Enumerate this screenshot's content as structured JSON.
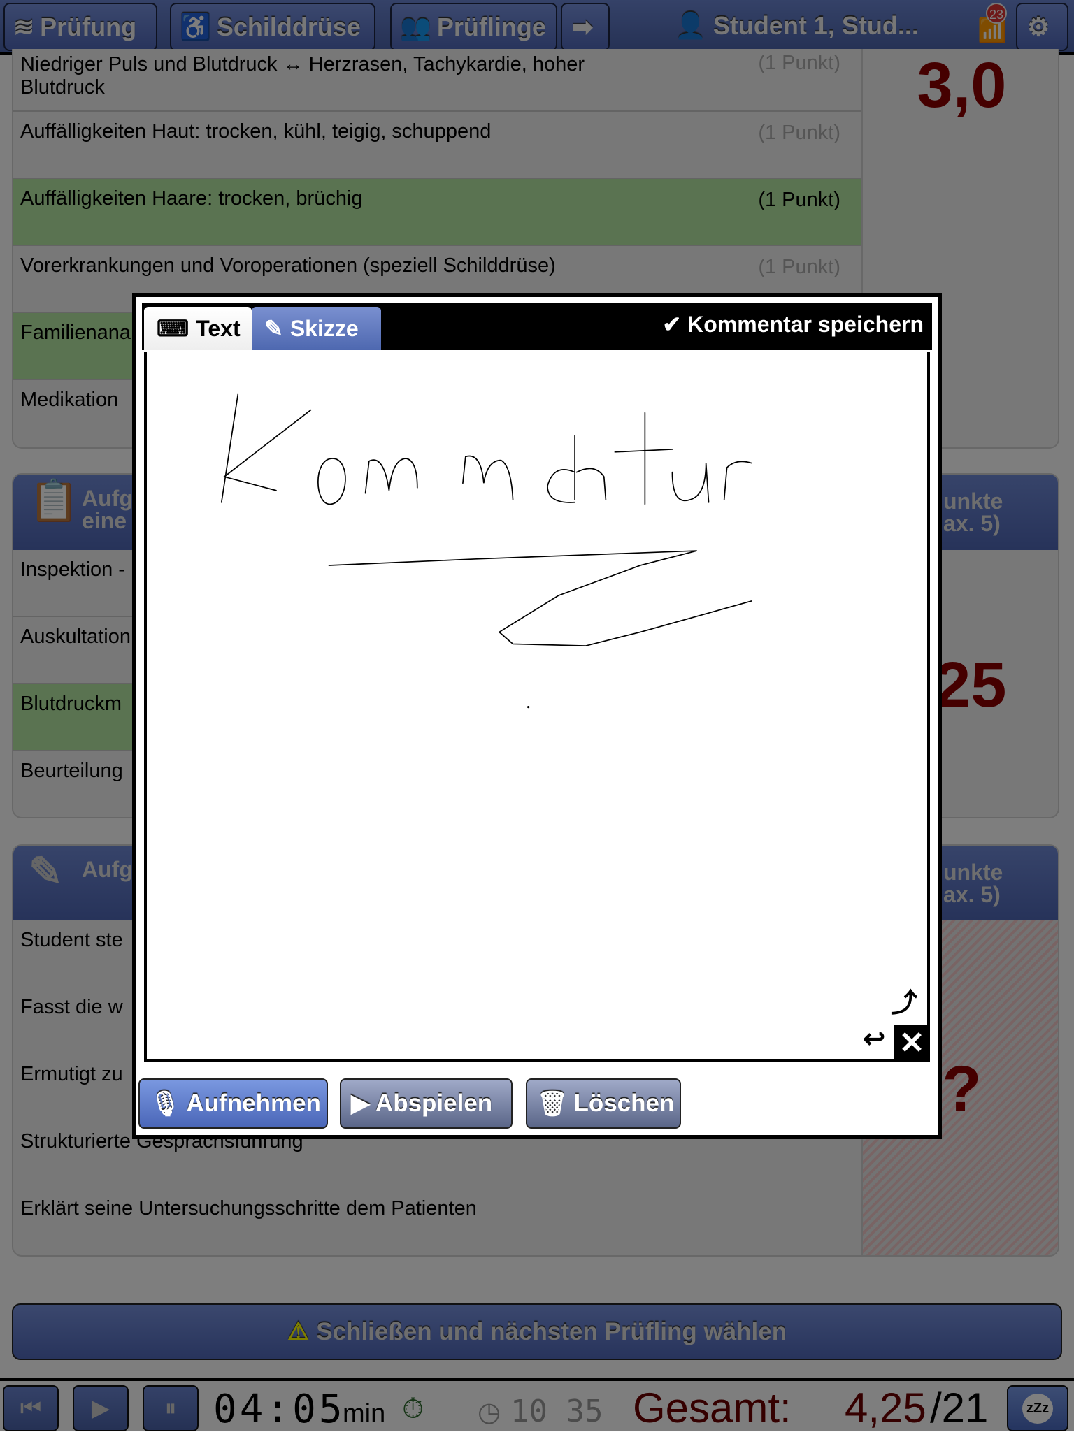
{
  "topbar": {
    "pruefung": "Prüfung",
    "schilddruese": "Schilddrüse",
    "prueflinge": "Prüflinge",
    "student": "Student 1, Stud...",
    "badge_count": "23"
  },
  "section1": {
    "rows": [
      {
        "text": "Niedriger Puls und Blutdruck ↔ Herzrasen, Tachykardie, hoher Blutdruck",
        "points": "(1 Punkt)",
        "selected": false
      },
      {
        "text": "Auffälligkeiten Haut: trocken, kühl, teigig, schuppend",
        "points": "(1 Punkt)",
        "selected": false
      },
      {
        "text": "Auffälligkeiten Haare: trocken, brüchig",
        "points": "(1 Punkt)",
        "selected": true
      },
      {
        "text": "Vorerkrankungen und Voroperationen (speziell Schilddrüse)",
        "points": "(1 Punkt)",
        "selected": false
      },
      {
        "text": "Familienana",
        "points": "",
        "selected": true
      },
      {
        "text": "Medikation",
        "points": "",
        "selected": false
      }
    ],
    "score": "3,0"
  },
  "section2": {
    "title_line1": "Aufg",
    "title_line2": "eine",
    "points_header_line1": "unkte",
    "points_header_line2": "ax. 5)",
    "rows": [
      {
        "text": "Inspektion -",
        "selected": false
      },
      {
        "text": "Auskultation",
        "selected": false
      },
      {
        "text": "Blutdruckm",
        "selected": true
      },
      {
        "text": "Beurteilung",
        "selected": false
      }
    ],
    "score": ",25"
  },
  "section3": {
    "title_line1": "Aufg",
    "points_header_line1": "unkte",
    "points_header_line2": "ax. 5)",
    "rows": [
      {
        "text": "Student ste"
      },
      {
        "text": "Fasst die w"
      },
      {
        "text": "Ermutigt zu"
      },
      {
        "text": "Strukturierte Gesprächsführung"
      },
      {
        "text": "Erklärt seine Untersuchungsschritte dem Patienten"
      }
    ],
    "score": "?"
  },
  "close_next": "Schließen und nächsten Prüfling wählen",
  "modal": {
    "tab_text": "Text",
    "tab_sketch": "Skizze",
    "save": "Kommentar speichern",
    "record": "Aufnehmen",
    "play": "Abspielen",
    "delete": "Löschen",
    "active_tab": "Skizze"
  },
  "bottombar": {
    "timer": "04:05",
    "timer_unit": "min",
    "clock": "10 35",
    "total_label": "Gesamt:",
    "total_score": "4,25",
    "total_max": "/21"
  },
  "colors": {
    "accent": "#5a72c0",
    "score": "#8b0000",
    "selected_row": "#b5e6a2"
  }
}
